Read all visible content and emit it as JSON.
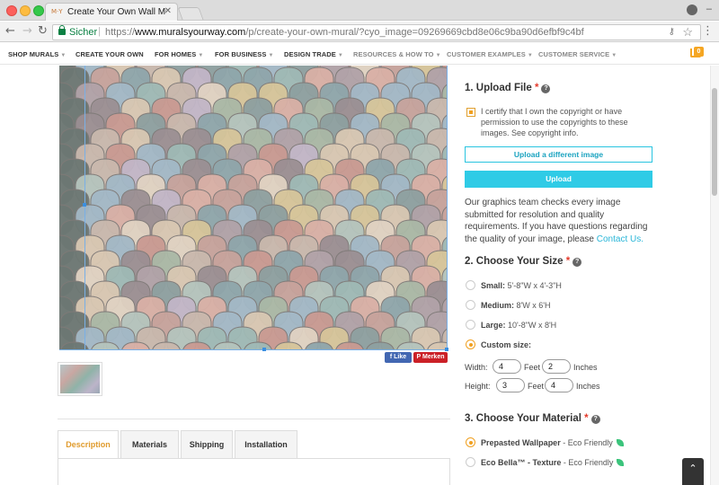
{
  "browser": {
    "tab_title": "Create Your Own Wall Mural -",
    "tab_favicon": "M·Y",
    "secure_label": "Sicher",
    "url_scheme": "https://",
    "url_host": "www.muralsyourway.com",
    "url_path": "/p/create-your-own-mural/?cyo_image=09269669cbd8e06c9ba90d6efbf9c4bf"
  },
  "sitenav": {
    "items": [
      {
        "label": "SHOP MURALS"
      },
      {
        "label": "CREATE YOUR OWN"
      },
      {
        "label": "FOR HOMES"
      },
      {
        "label": "FOR BUSINESS"
      },
      {
        "label": "DESIGN TRADE"
      },
      {
        "label": "RESOURCES & HOW TO"
      },
      {
        "label": "CUSTOMER EXAMPLES"
      },
      {
        "label": "CUSTOMER SERVICE"
      }
    ],
    "cart_count": "0"
  },
  "social": {
    "like_label": "Like",
    "pin_label": "Merken"
  },
  "product_tabs": [
    {
      "label": "Description"
    },
    {
      "label": "Materials"
    },
    {
      "label": "Shipping"
    },
    {
      "label": "Installation"
    }
  ],
  "upload": {
    "title": "1. Upload File",
    "required": "*",
    "certify_text": "I certify that I own the copyright or have permission to use the copyrights to these images. See copyright info.",
    "upload_different_label": "Upload a different image",
    "upload_label": "Upload",
    "graphics_text": "Our graphics team checks every image submitted for resolution and quality requirements. If you have questions regarding the quality of your image, please",
    "contact_link": "Contact Us."
  },
  "size": {
    "title": "2. Choose Your Size",
    "required": "*",
    "options": [
      {
        "name": "Small:",
        "dims": "5'-8\"W x 4'-3\"H"
      },
      {
        "name": "Medium:",
        "dims": "8'W x 6'H"
      },
      {
        "name": "Large:",
        "dims": "10'-8\"W x 8'H"
      },
      {
        "name": "Custom size:",
        "dims": ""
      }
    ],
    "width_label": "Width:",
    "height_label": "Height:",
    "feet_label": "Feet",
    "inches_label": "Inches",
    "width_feet": "4",
    "width_inches": "2",
    "height_feet": "3",
    "height_inches": "4"
  },
  "material": {
    "title": "3. Choose Your Material",
    "required": "*",
    "options": [
      {
        "name": "Prepasted Wallpaper",
        "note": " - Eco Friendly"
      },
      {
        "name": "Eco Bella™ - Texture",
        "note": " - Eco Friendly"
      }
    ]
  },
  "colors": {
    "accent": "#f0a020",
    "cyan": "#2fcbe6",
    "required": "#e53b2c"
  }
}
